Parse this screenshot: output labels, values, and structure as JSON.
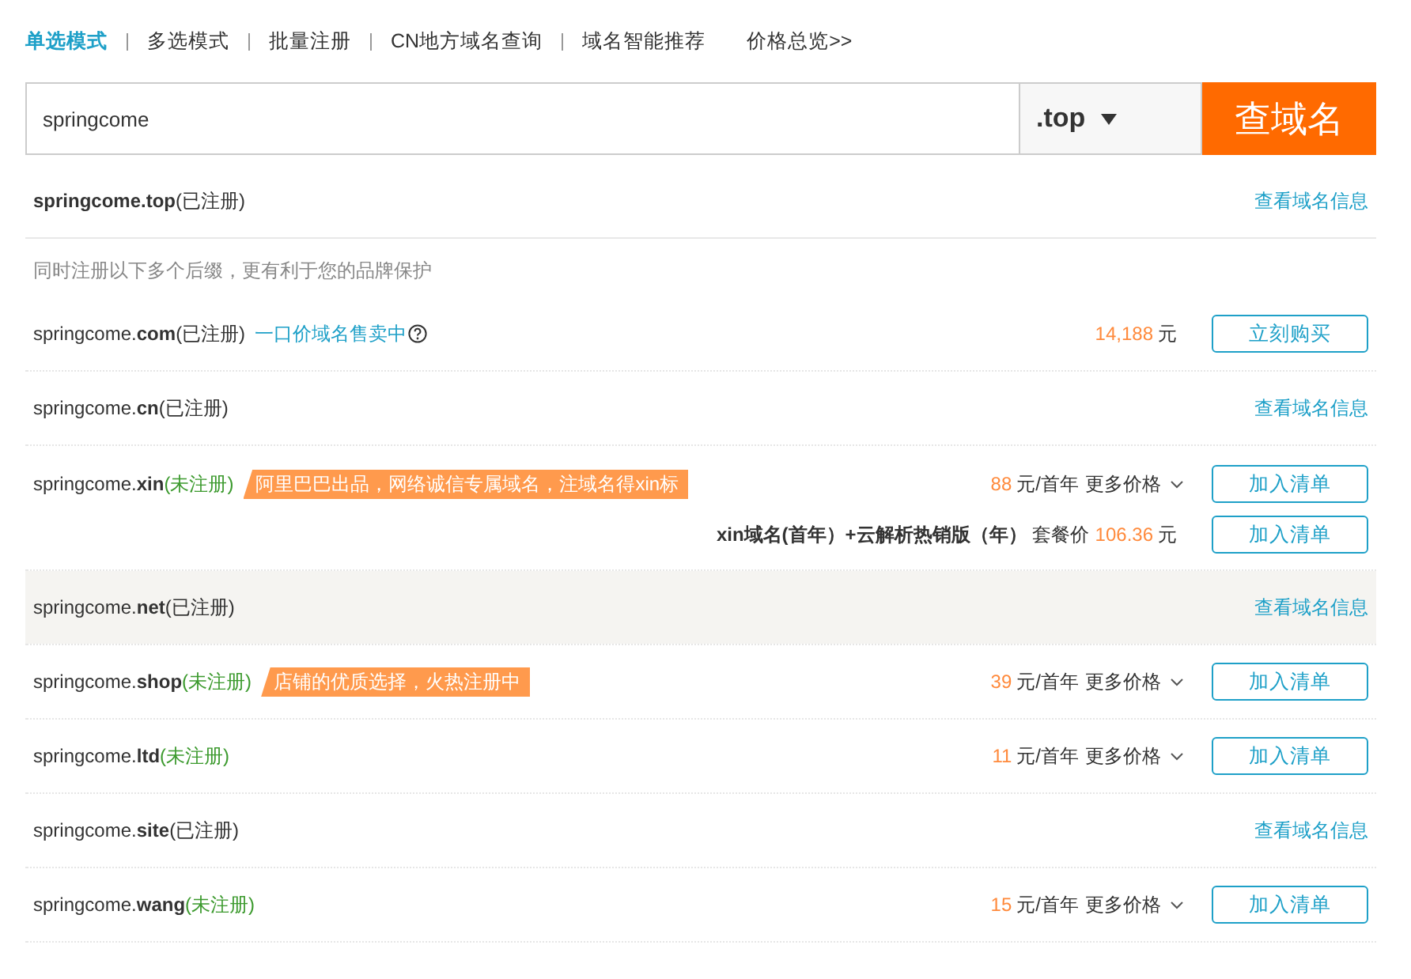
{
  "tabs": [
    {
      "label": "单选模式",
      "selected": true
    },
    {
      "label": "多选模式",
      "selected": false
    },
    {
      "label": "批量注册",
      "selected": false
    },
    {
      "label": "CN地方域名查询",
      "selected": false
    },
    {
      "label": "域名智能推荐",
      "selected": false
    }
  ],
  "price_overview": "价格总览>>",
  "search": {
    "value": "springcome",
    "suffix": ".top",
    "button": "查域名"
  },
  "main_result": {
    "domain": "springcome.top",
    "status": "(已注册)",
    "registered": true,
    "action": "查看域名信息"
  },
  "hint": "同时注册以下多个后缀，更有利于您的品牌保护",
  "results": [
    {
      "kind": "sale",
      "domain": "springcome.**com**",
      "status": "(已注册)",
      "registered": true,
      "hovered": false,
      "sale_link": "一口价域名售卖中",
      "price": "14,188",
      "unit": "元",
      "button": "立刻购买"
    },
    {
      "kind": "info",
      "domain": "springcome.**cn**",
      "status": "(已注册)",
      "registered": true,
      "hovered": false,
      "action": "查看域名信息"
    },
    {
      "kind": "offer",
      "domain": "springcome.**xin**",
      "status": "(未注册)",
      "registered": false,
      "hovered": false,
      "tag": "阿里巴巴出品，网络诚信专属域名，注域名得xin标",
      "price": "88",
      "unit": "元/首年",
      "more": "更多价格",
      "button": "加入清单",
      "bundle": {
        "name": "xin域名(首年）+云解析热销版（年）",
        "label": "套餐价",
        "price": "106.36",
        "unit": "元",
        "button": "加入清单"
      }
    },
    {
      "kind": "info",
      "domain": "springcome.**net**",
      "status": "(已注册)",
      "registered": true,
      "hovered": true,
      "action": "查看域名信息"
    },
    {
      "kind": "offer",
      "domain": "springcome.**shop**",
      "status": "(未注册)",
      "registered": false,
      "hovered": false,
      "tag": "店铺的优质选择，火热注册中",
      "price": "39",
      "unit": "元/首年",
      "more": "更多价格",
      "button": "加入清单"
    },
    {
      "kind": "offer",
      "domain": "springcome.**ltd**",
      "status": "(未注册)",
      "registered": false,
      "hovered": false,
      "price": "11",
      "unit": "元/首年",
      "more": "更多价格",
      "button": "加入清单"
    },
    {
      "kind": "info",
      "domain": "springcome.**site**",
      "status": "(已注册)",
      "registered": true,
      "hovered": false,
      "action": "查看域名信息"
    },
    {
      "kind": "offer",
      "domain": "springcome.**wang**",
      "status": "(未注册)",
      "registered": false,
      "hovered": false,
      "price": "15",
      "unit": "元/首年",
      "more": "更多价格",
      "button": "加入清单"
    }
  ]
}
